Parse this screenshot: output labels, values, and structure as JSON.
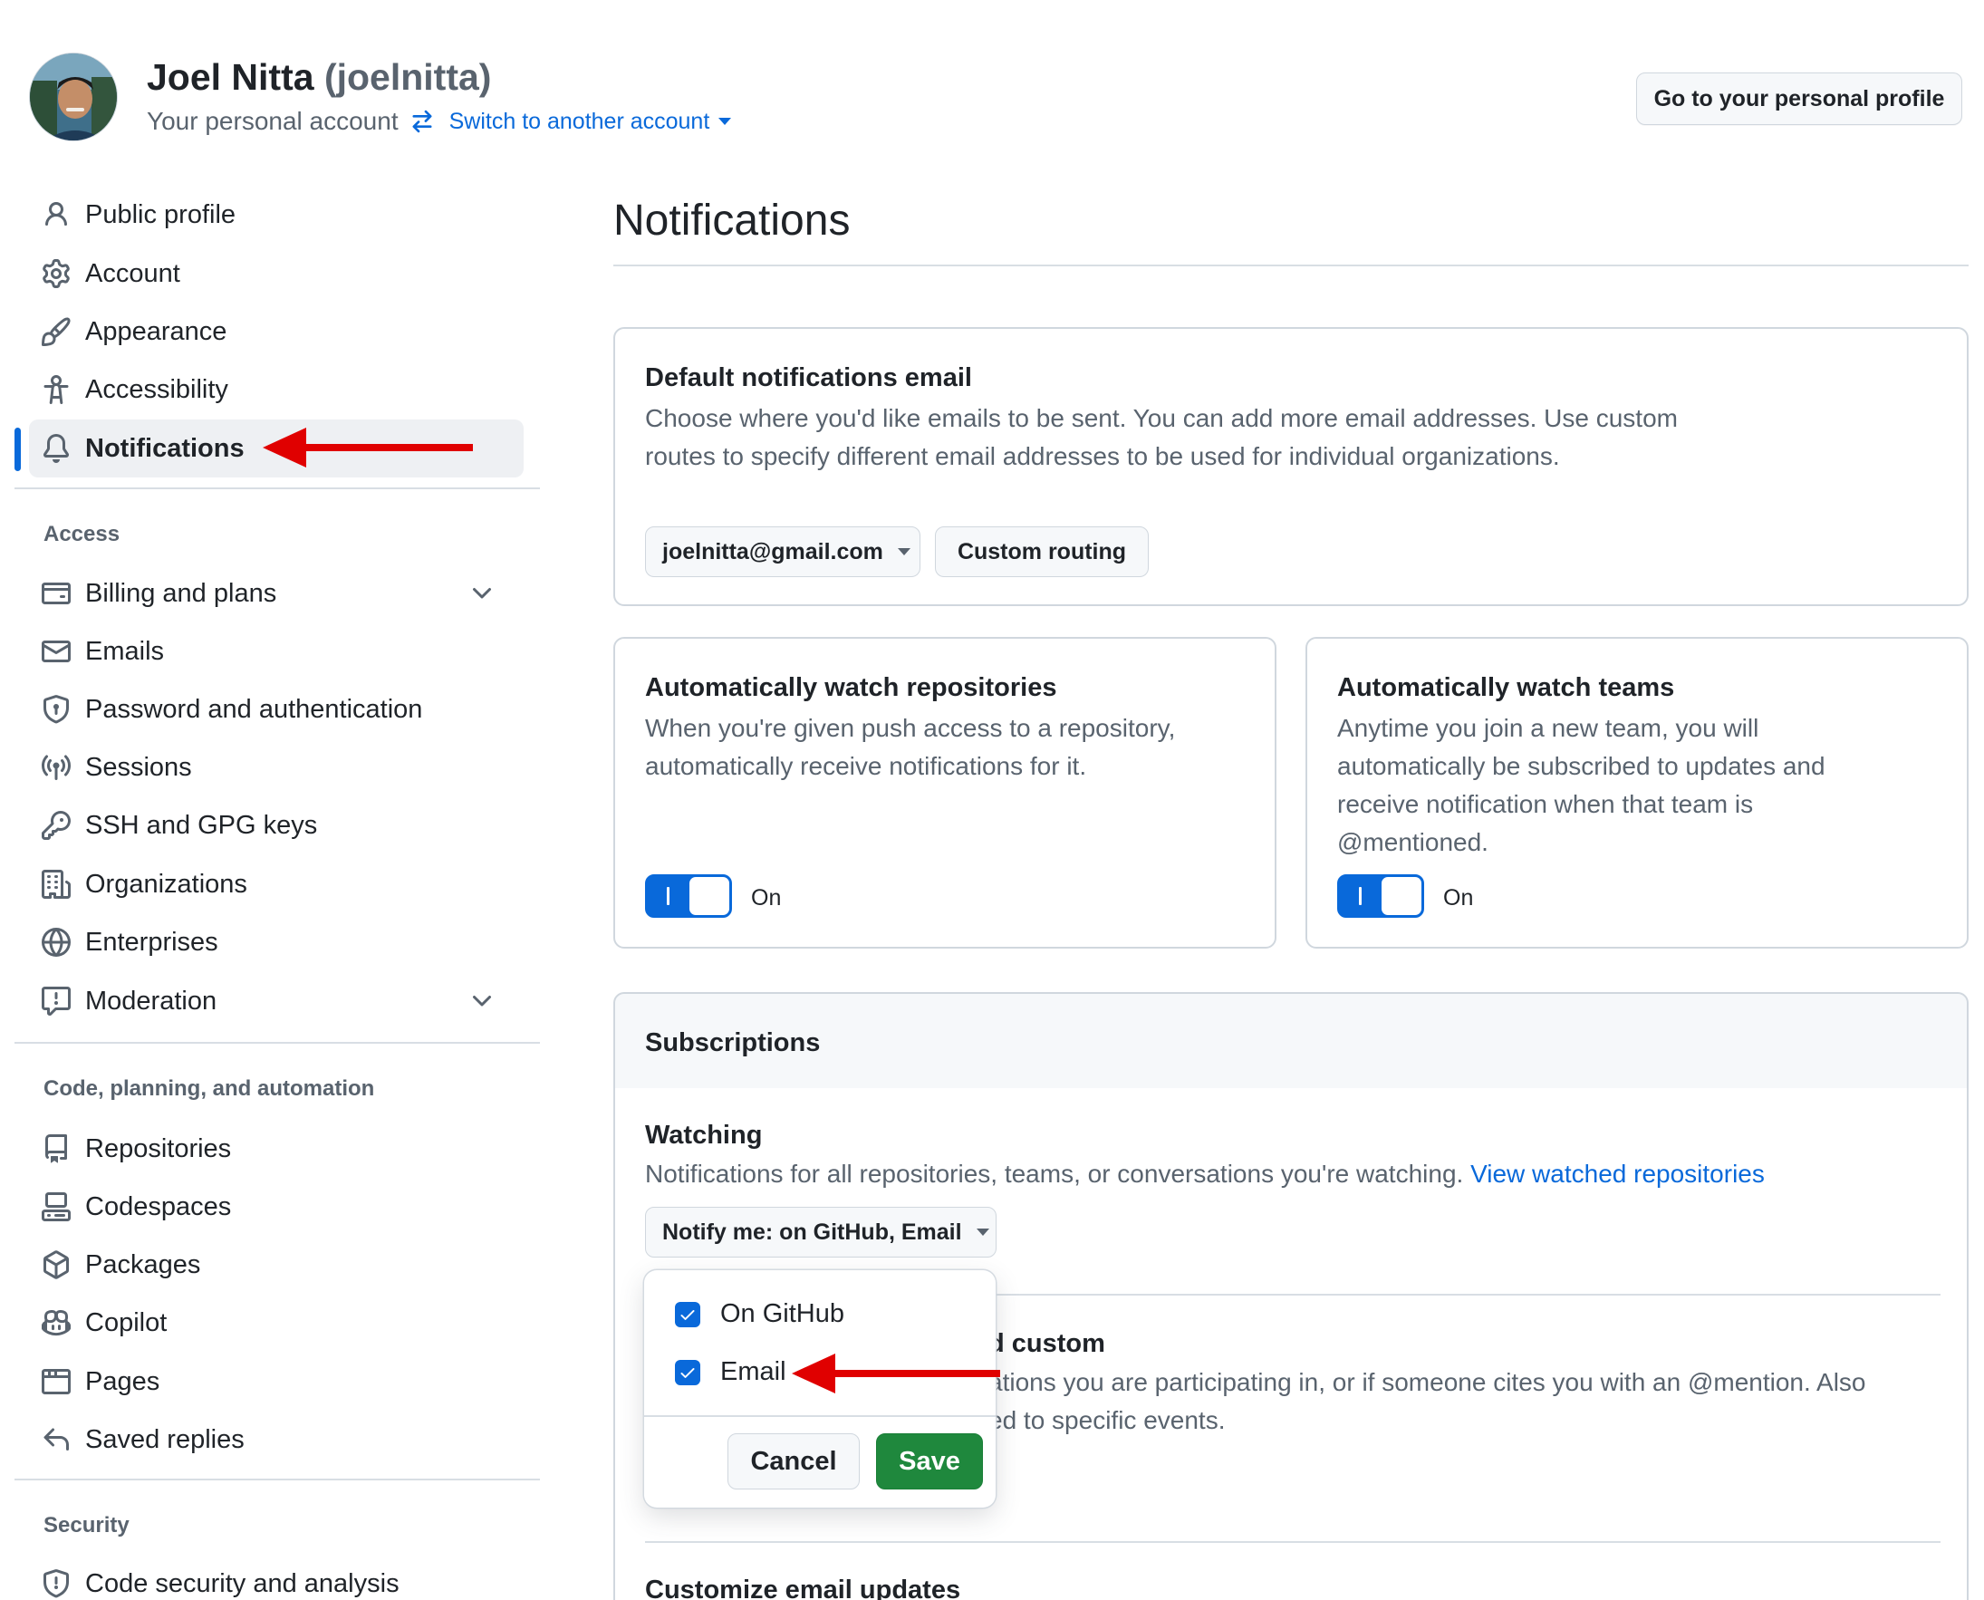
{
  "colors": {
    "accent": "#0969da",
    "save_green": "#1f883d",
    "annotation_red": "#e00000",
    "muted_text": "#59636e",
    "border": "#d0d7de"
  },
  "header": {
    "display_name": "Joel Nitta",
    "login": "(joelnitta)",
    "subtitle": "Your personal account",
    "switch_account_label": "Switch to another account",
    "profile_button_label": "Go to your personal profile"
  },
  "sidebar": {
    "items": [
      {
        "label": "Public profile",
        "icon": "person-icon"
      },
      {
        "label": "Account",
        "icon": "gear-icon"
      },
      {
        "label": "Appearance",
        "icon": "paintbrush-icon"
      },
      {
        "label": "Accessibility",
        "icon": "accessibility-icon"
      },
      {
        "label": "Notifications",
        "icon": "bell-icon",
        "active": true
      }
    ],
    "access_heading": "Access",
    "access_items": [
      {
        "label": "Billing and plans",
        "icon": "credit-card-icon",
        "expandable": true
      },
      {
        "label": "Emails",
        "icon": "mail-icon"
      },
      {
        "label": "Password and authentication",
        "icon": "shield-lock-icon"
      },
      {
        "label": "Sessions",
        "icon": "broadcast-icon"
      },
      {
        "label": "SSH and GPG keys",
        "icon": "key-icon"
      },
      {
        "label": "Organizations",
        "icon": "organization-icon"
      },
      {
        "label": "Enterprises",
        "icon": "globe-icon"
      },
      {
        "label": "Moderation",
        "icon": "report-icon",
        "expandable": true
      }
    ],
    "code_heading": "Code, planning, and automation",
    "code_items": [
      {
        "label": "Repositories",
        "icon": "repo-icon"
      },
      {
        "label": "Codespaces",
        "icon": "codespaces-icon"
      },
      {
        "label": "Packages",
        "icon": "package-icon"
      },
      {
        "label": "Copilot",
        "icon": "copilot-icon"
      },
      {
        "label": "Pages",
        "icon": "browser-icon"
      },
      {
        "label": "Saved replies",
        "icon": "reply-icon"
      }
    ],
    "security_heading": "Security",
    "security_items": [
      {
        "label": "Code security and analysis",
        "icon": "shield-icon"
      }
    ]
  },
  "main": {
    "title": "Notifications",
    "default_email": {
      "title": "Default notifications email",
      "description": "Choose where you'd like emails to be sent. You can add more email addresses. Use custom routes to specify different email addresses to be used for individual organizations.",
      "email_select_value": "joelnitta@gmail.com",
      "custom_routing_label": "Custom routing"
    },
    "watch_repos": {
      "title": "Automatically watch repositories",
      "description": "When you're given push access to a repository, automatically receive notifications for it.",
      "toggle_label": "On",
      "enabled": true
    },
    "watch_teams": {
      "title": "Automatically watch teams",
      "description": "Anytime you join a new team, you will automatically be subscribed to updates and receive notification when that team is @mentioned.",
      "toggle_label": "On",
      "enabled": true
    },
    "subscriptions": {
      "header": "Subscriptions",
      "watching_title": "Watching",
      "watching_desc": "Notifications for all repositories, teams, or conversations you're watching.",
      "watching_link": "View watched repositories",
      "notify_select_value": "Notify me: on GitHub, Email",
      "participating_title_visible": "d custom",
      "participating_desc_line1_visible": "ations you are participating in, or if someone cites you with an @mention. Also",
      "participating_desc_line2_visible": "ed to specific events.",
      "customize_title": "Customize email updates"
    },
    "dropdown": {
      "options": [
        {
          "label": "On GitHub",
          "checked": true
        },
        {
          "label": "Email",
          "checked": true
        }
      ],
      "cancel_label": "Cancel",
      "save_label": "Save"
    }
  }
}
